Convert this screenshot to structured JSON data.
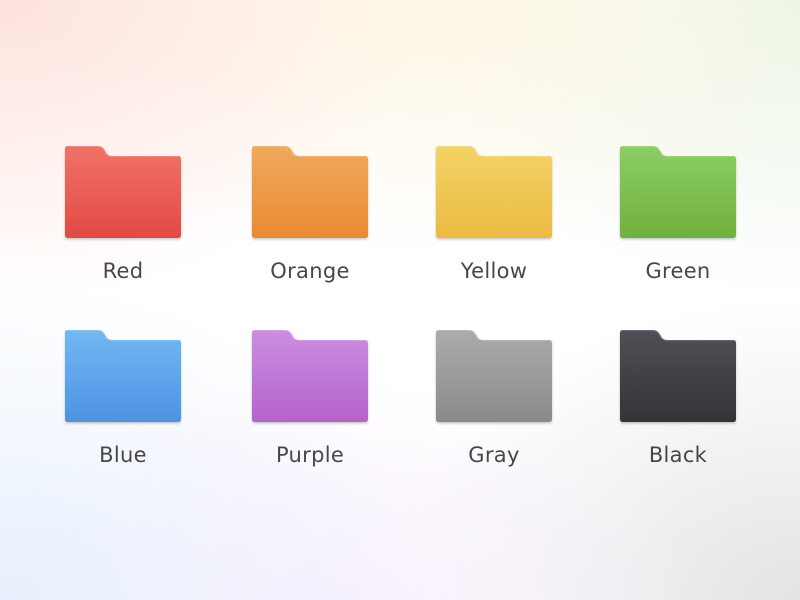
{
  "folders": [
    {
      "label": "Red",
      "icon": "red-folder-icon",
      "top_color": "#F07366",
      "bottom_color": "#E24A44"
    },
    {
      "label": "Orange",
      "icon": "orange-folder-icon",
      "top_color": "#EFA95B",
      "bottom_color": "#E98A33"
    },
    {
      "label": "Yellow",
      "icon": "yellow-folder-icon",
      "top_color": "#F2D367",
      "bottom_color": "#EBBA42"
    },
    {
      "label": "Green",
      "icon": "green-folder-icon",
      "top_color": "#8CCE65",
      "bottom_color": "#70B03E"
    },
    {
      "label": "Blue",
      "icon": "blue-folder-icon",
      "top_color": "#72B8F2",
      "bottom_color": "#4C93E3"
    },
    {
      "label": "Purple",
      "icon": "purple-folder-icon",
      "top_color": "#CB8EE0",
      "bottom_color": "#B363CD"
    },
    {
      "label": "Gray",
      "icon": "gray-folder-icon",
      "top_color": "#ABABAB",
      "bottom_color": "#8A8A8A"
    },
    {
      "label": "Black",
      "icon": "black-folder-icon",
      "top_color": "#505055",
      "bottom_color": "#333338"
    }
  ]
}
